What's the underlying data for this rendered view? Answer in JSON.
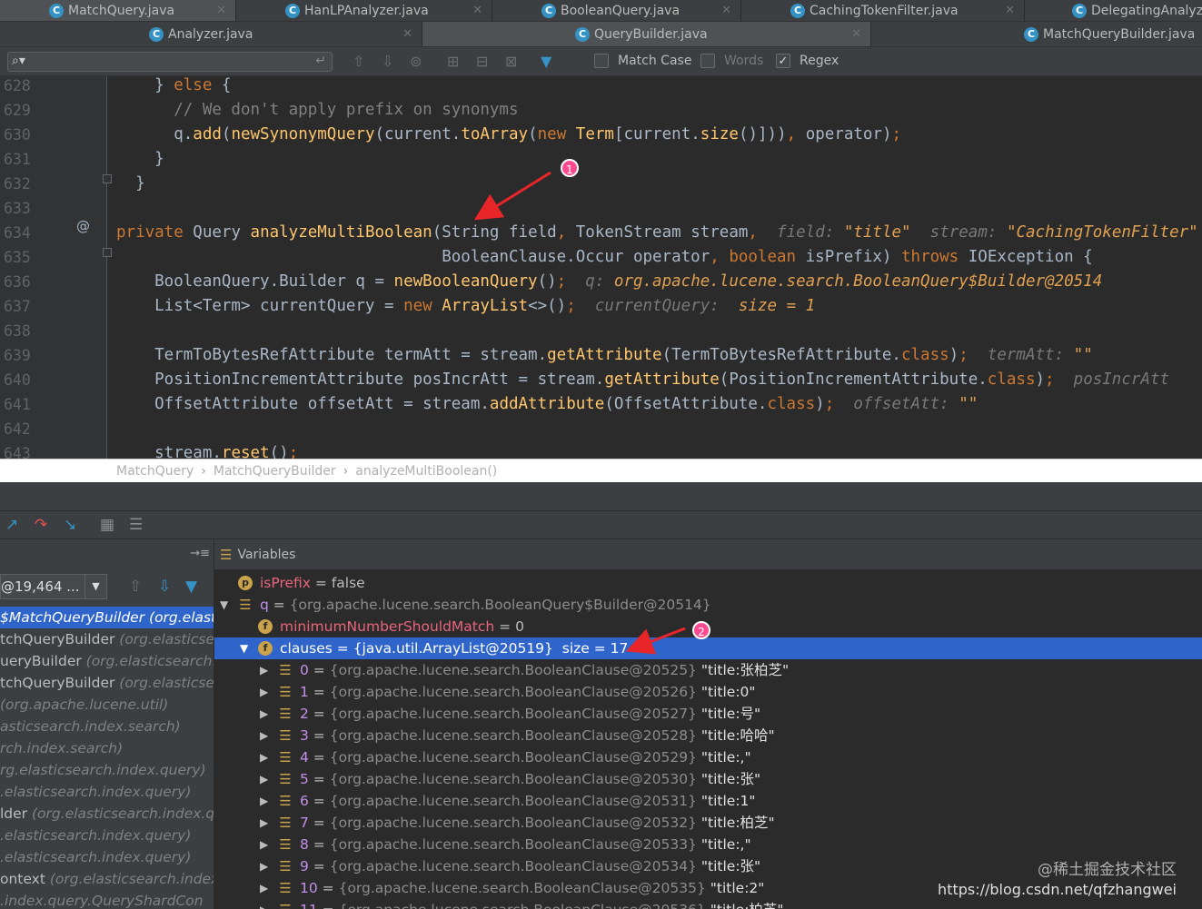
{
  "tabs_row1": [
    {
      "label": "MatchQuery.java",
      "active": true
    },
    {
      "label": "HanLPAnalyzer.java"
    },
    {
      "label": "BooleanQuery.java"
    },
    {
      "label": "CachingTokenFilter.java"
    },
    {
      "label": "DelegatingAnalyze"
    }
  ],
  "tabs_row2": [
    {
      "label": "Analyzer.java"
    },
    {
      "label": "QueryBuilder.java",
      "active": true
    },
    {
      "label": "MatchQueryBuilder.java"
    }
  ],
  "search": {
    "value": "",
    "options": [
      {
        "label": "Match Case",
        "checked": false
      },
      {
        "label": "Words",
        "checked": false
      },
      {
        "label": "Regex",
        "checked": true
      }
    ]
  },
  "editor": {
    "lines": [
      {
        "n": "628",
        "parts": [
          [
            "pl",
            "    } "
          ],
          [
            "kw",
            "else"
          ],
          [
            "pl",
            " {"
          ]
        ]
      },
      {
        "n": "629",
        "parts": [
          [
            "cm",
            "      // We don't apply prefix on synonyms"
          ]
        ]
      },
      {
        "n": "630",
        "parts": [
          [
            "pl",
            "      q."
          ],
          [
            "mc",
            "add"
          ],
          [
            "pl",
            "("
          ],
          [
            "mc",
            "newSynonymQuery"
          ],
          [
            "pl",
            "(current."
          ],
          [
            "mc",
            "toArray"
          ],
          [
            "pl",
            "("
          ],
          [
            "kw",
            "new"
          ],
          [
            "pl",
            " "
          ],
          [
            "fn",
            "Term"
          ],
          [
            "pl",
            "[current."
          ],
          [
            "mc",
            "size"
          ],
          [
            "pl",
            "()]))"
          ],
          [
            "kw",
            ","
          ],
          [
            "pl",
            " operator)"
          ],
          [
            "kw",
            ";"
          ]
        ]
      },
      {
        "n": "631",
        "parts": [
          [
            "pl",
            "    }"
          ]
        ]
      },
      {
        "n": "632",
        "parts": [
          [
            "pl",
            "  }"
          ]
        ]
      },
      {
        "n": "633",
        "parts": []
      },
      {
        "n": "634",
        "parts": [
          [
            "kw",
            "private"
          ],
          [
            "pl",
            " Query "
          ],
          [
            "fn",
            "analyzeMultiBoolean"
          ],
          [
            "pl",
            "(String field"
          ],
          [
            "kw",
            ","
          ],
          [
            "pl",
            " TokenStream stream"
          ],
          [
            "kw",
            ","
          ],
          [
            "pl",
            "  "
          ],
          [
            "hint",
            "field: "
          ],
          [
            "hs",
            "\"title\""
          ],
          [
            "pl",
            "  "
          ],
          [
            "hint",
            "stream: "
          ],
          [
            "hs",
            "\"CachingTokenFilter\""
          ]
        ]
      },
      {
        "n": "635",
        "parts": [
          [
            "pl",
            "                                  BooleanClause.Occur operator"
          ],
          [
            "kw",
            ","
          ],
          [
            "pl",
            " "
          ],
          [
            "kw",
            "boolean"
          ],
          [
            "pl",
            " isPrefix) "
          ],
          [
            "kw",
            "throws"
          ],
          [
            "pl",
            " IOException {"
          ]
        ]
      },
      {
        "n": "636",
        "parts": [
          [
            "pl",
            "    BooleanQuery.Builder q = "
          ],
          [
            "mc",
            "newBooleanQuery"
          ],
          [
            "pl",
            "()"
          ],
          [
            "kw",
            ";"
          ],
          [
            "pl",
            "  "
          ],
          [
            "hint",
            "q: "
          ],
          [
            "hs",
            "org.apache.lucene.search.BooleanQuery$Builder@20514"
          ]
        ]
      },
      {
        "n": "637",
        "parts": [
          [
            "pl",
            "    List<Term> currentQuery = "
          ],
          [
            "kw",
            "new"
          ],
          [
            "pl",
            " "
          ],
          [
            "fn",
            "ArrayList"
          ],
          [
            "pl",
            "<>()"
          ],
          [
            "kw",
            ";"
          ],
          [
            "pl",
            "  "
          ],
          [
            "hint",
            "currentQuery:  "
          ],
          [
            "hs",
            "size = 1"
          ]
        ]
      },
      {
        "n": "638",
        "parts": []
      },
      {
        "n": "639",
        "parts": [
          [
            "pl",
            "    TermToBytesRefAttribute termAtt = stream."
          ],
          [
            "mc",
            "getAttribute"
          ],
          [
            "pl",
            "(TermToBytesRefAttribute."
          ],
          [
            "kw",
            "class"
          ],
          [
            "pl",
            ")"
          ],
          [
            "kw",
            ";"
          ],
          [
            "pl",
            "  "
          ],
          [
            "hint",
            "termAtt: "
          ],
          [
            "hs",
            "\"\""
          ]
        ]
      },
      {
        "n": "640",
        "parts": [
          [
            "pl",
            "    PositionIncrementAttribute posIncrAtt = stream."
          ],
          [
            "mc",
            "getAttribute"
          ],
          [
            "pl",
            "(PositionIncrementAttribute."
          ],
          [
            "kw",
            "class"
          ],
          [
            "pl",
            ")"
          ],
          [
            "kw",
            ";"
          ],
          [
            "pl",
            "  "
          ],
          [
            "hint",
            "posIncrAtt"
          ]
        ]
      },
      {
        "n": "641",
        "parts": [
          [
            "pl",
            "    OffsetAttribute offsetAtt = stream."
          ],
          [
            "mc",
            "addAttribute"
          ],
          [
            "pl",
            "(OffsetAttribute."
          ],
          [
            "kw",
            "class"
          ],
          [
            "pl",
            ")"
          ],
          [
            "kw",
            ";"
          ],
          [
            "pl",
            "  "
          ],
          [
            "hint",
            "offsetAtt: "
          ],
          [
            "hs",
            "\"\""
          ]
        ]
      },
      {
        "n": "642",
        "parts": []
      },
      {
        "n": "643",
        "parts": [
          [
            "pl",
            "    stream."
          ],
          [
            "mc",
            "reset"
          ],
          [
            "pl",
            "()"
          ],
          [
            "kw",
            ";"
          ]
        ]
      }
    ]
  },
  "breadcrumb": [
    "MatchQuery",
    "MatchQueryBuilder",
    "analyzeMultiBoolean()"
  ],
  "frames": {
    "thread": "@19,464 ...",
    "items": [
      {
        "main": "$MatchQueryBuilder ",
        "pkg": "(org.elast",
        "selected": true
      },
      {
        "main": "tchQueryBuilder ",
        "pkg": "(org.elasticse"
      },
      {
        "main": "ueryBuilder ",
        "pkg": "(org.elasticsearch."
      },
      {
        "main": "tchQueryBuilder ",
        "pkg": "(org.elasticse"
      },
      {
        "main": "",
        "pkg": "(org.apache.lucene.util)"
      },
      {
        "main": "",
        "pkg": "asticsearch.index.search)"
      },
      {
        "main": "",
        "pkg": "rch.index.search)"
      },
      {
        "main": "",
        "pkg": "rg.elasticsearch.index.query)"
      },
      {
        "main": "",
        "pkg": ".elasticsearch.index.query)"
      },
      {
        "main": "lder ",
        "pkg": "(org.elasticsearch.index.q"
      },
      {
        "main": "",
        "pkg": ".elasticsearch.index.query)"
      },
      {
        "main": "",
        "pkg": ".elasticsearch.index.query)"
      },
      {
        "main": "ontext ",
        "pkg": "(org.elasticsearch.index"
      },
      {
        "main": "",
        "pkg": ".index.query.QueryShardCon"
      }
    ]
  },
  "variables": {
    "header": "Variables",
    "rows": [
      {
        "indent": 0,
        "icon": "p",
        "twisty": "",
        "name": "isPrefix",
        "name_class": "red",
        "eq": " = ",
        "val": "false",
        "obj": ""
      },
      {
        "indent": 0,
        "icon": "list",
        "twisty": "▼",
        "name": "q",
        "name_class": "lav",
        "eq": " = ",
        "val": "",
        "obj": "{org.apache.lucene.search.BooleanQuery$Builder@20514}"
      },
      {
        "indent": 1,
        "icon": "f",
        "twisty": "",
        "name": "minimumNumberShouldMatch",
        "name_class": "red",
        "eq": " = ",
        "val": "0",
        "obj": ""
      },
      {
        "indent": 1,
        "icon": "f",
        "twisty": "▼",
        "name": "clauses",
        "name_class": "red",
        "eq": " = ",
        "val": "{java.util.ArrayList@20519}  size = 17",
        "obj": "",
        "selected": true
      },
      {
        "indent": 2,
        "icon": "list",
        "twisty": "▶",
        "name": "0",
        "name_class": "lav",
        "eq": " = ",
        "obj": "{org.apache.lucene.search.BooleanClause@20525}",
        "val": " \"title:张柏芝\""
      },
      {
        "indent": 2,
        "icon": "list",
        "twisty": "▶",
        "name": "1",
        "name_class": "lav",
        "eq": " = ",
        "obj": "{org.apache.lucene.search.BooleanClause@20526}",
        "val": " \"title:0\""
      },
      {
        "indent": 2,
        "icon": "list",
        "twisty": "▶",
        "name": "2",
        "name_class": "lav",
        "eq": " = ",
        "obj": "{org.apache.lucene.search.BooleanClause@20527}",
        "val": " \"title:号\""
      },
      {
        "indent": 2,
        "icon": "list",
        "twisty": "▶",
        "name": "3",
        "name_class": "lav",
        "eq": " = ",
        "obj": "{org.apache.lucene.search.BooleanClause@20528}",
        "val": " \"title:哈哈\""
      },
      {
        "indent": 2,
        "icon": "list",
        "twisty": "▶",
        "name": "4",
        "name_class": "lav",
        "eq": " = ",
        "obj": "{org.apache.lucene.search.BooleanClause@20529}",
        "val": " \"title:,\""
      },
      {
        "indent": 2,
        "icon": "list",
        "twisty": "▶",
        "name": "5",
        "name_class": "lav",
        "eq": " = ",
        "obj": "{org.apache.lucene.search.BooleanClause@20530}",
        "val": " \"title:张\""
      },
      {
        "indent": 2,
        "icon": "list",
        "twisty": "▶",
        "name": "6",
        "name_class": "lav",
        "eq": " = ",
        "obj": "{org.apache.lucene.search.BooleanClause@20531}",
        "val": " \"title:1\""
      },
      {
        "indent": 2,
        "icon": "list",
        "twisty": "▶",
        "name": "7",
        "name_class": "lav",
        "eq": " = ",
        "obj": "{org.apache.lucene.search.BooleanClause@20532}",
        "val": " \"title:柏芝\""
      },
      {
        "indent": 2,
        "icon": "list",
        "twisty": "▶",
        "name": "8",
        "name_class": "lav",
        "eq": " = ",
        "obj": "{org.apache.lucene.search.BooleanClause@20533}",
        "val": " \"title:,\""
      },
      {
        "indent": 2,
        "icon": "list",
        "twisty": "▶",
        "name": "9",
        "name_class": "lav",
        "eq": " = ",
        "obj": "{org.apache.lucene.search.BooleanClause@20534}",
        "val": " \"title:张\""
      },
      {
        "indent": 2,
        "icon": "list",
        "twisty": "▶",
        "name": "10",
        "name_class": "lav",
        "eq": " = ",
        "obj": "{org.apache.lucene.search.BooleanClause@20535}",
        "val": " \"title:2\""
      },
      {
        "indent": 2,
        "icon": "list",
        "twisty": "▶",
        "name": "11",
        "name_class": "lav",
        "eq": " = ",
        "obj": "{org.apache.lucene.search.BooleanClause@20536}",
        "val": " \"title:柏芝\""
      }
    ]
  },
  "annotations": {
    "badge1": "1",
    "badge2": "2"
  },
  "watermark": {
    "line1": "@稀土掘金技术社区",
    "line2": "https://blog.csdn.net/qfzhangwei"
  },
  "colors": {
    "accent": "#2f65ca",
    "badge": "#ff4a8f",
    "arrow": "#e8262a"
  }
}
